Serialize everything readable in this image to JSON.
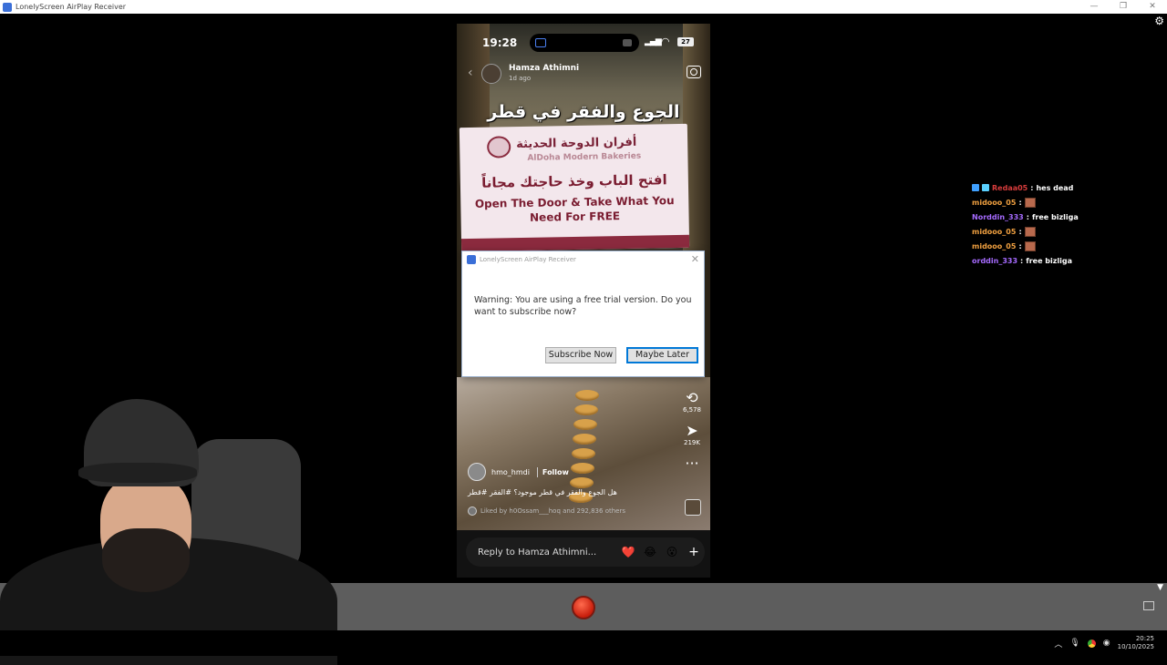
{
  "window": {
    "title": "LonelyScreen AirPlay Receiver",
    "controls": [
      "—",
      "❒",
      "✕"
    ]
  },
  "phone": {
    "status": {
      "time": "19:28",
      "battery": "27"
    },
    "story": {
      "username": "Hamza Athimni",
      "ago": "1d ago",
      "title_ar": "الجوع والفقر في قطر",
      "sign": {
        "brand_ar": "أفران الدوحة الحديثة",
        "brand_en": "AlDoha Modern Bakeries",
        "line_ar": "افتح الباب وخذ حاجتك مجاناً",
        "line_en": "Open The Door & Take What You Need For FREE"
      },
      "reshare_count": "6,578",
      "send_count": "219K",
      "poster": "hmo_hmdi",
      "follow_label": "Follow",
      "caption": "هل الجوع والفقر في قطر موجود؟ #الفقر #قطر",
      "liked_by": "Liked by h0Ossam___hoq and 292,836 others",
      "reply_placeholder": "Reply to Hamza Athimni...",
      "emojis": [
        "❤️",
        "😂",
        "😮"
      ]
    }
  },
  "dialog": {
    "title": "LonelyScreen AirPlay Receiver",
    "message": "Warning: You are using a free trial version. Do you want to subscribe now?",
    "subscribe_label": "Subscribe Now",
    "later_label": "Maybe Later"
  },
  "chat": [
    {
      "user": "Redaa05",
      "text": "hes dead",
      "color": "#d83c3c",
      "emote": false
    },
    {
      "user": "midooo_05",
      "text": "",
      "color": "#f0a040",
      "emote": true
    },
    {
      "user": "Norddin_333",
      "text": "free bizliga",
      "color": "#a66bff",
      "emote": false
    },
    {
      "user": "midooo_05",
      "text": "",
      "color": "#f0a040",
      "emote": true
    },
    {
      "user": "midooo_05",
      "text": "",
      "color": "#f0a040",
      "emote": true
    },
    {
      "user": "orddin_333",
      "text": "free bizliga",
      "color": "#a66bff",
      "emote": false
    }
  ],
  "taskbar": {
    "time": "20:25",
    "date": "10/10/2025"
  },
  "colors": {
    "record": "#d62b14",
    "dock": "#5d5d5d",
    "accent": "#0078d7"
  }
}
